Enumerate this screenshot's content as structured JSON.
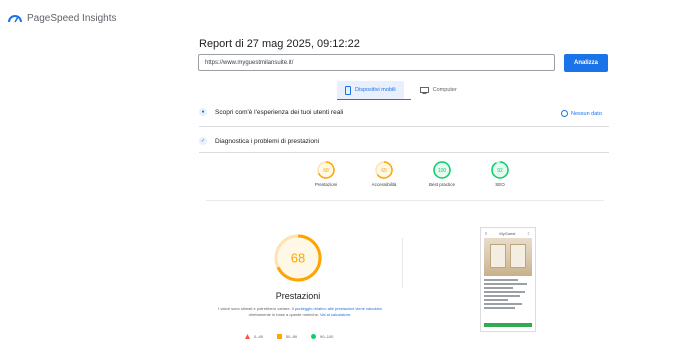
{
  "app": {
    "title": "PageSpeed Insights"
  },
  "report": {
    "title": "Report di 27 mag 2025, 09:12:22"
  },
  "url_input": {
    "value": "https://www.myguestmilansuite.it/"
  },
  "analyze_button": {
    "label": "Analizza"
  },
  "tabs": [
    {
      "label": "Dispositivi mobili",
      "active": true
    },
    {
      "label": "Computer",
      "active": false
    }
  ],
  "sections": {
    "real_users": {
      "label": "Scopri com'è l'esperienza dei tuoi utenti reali",
      "note": "Nessun dato"
    },
    "diagnostics": {
      "label": "Diagnostica i problemi di prestazioni"
    }
  },
  "scores": [
    {
      "label": "Prestazioni",
      "value": 68,
      "color": "#ffa400"
    },
    {
      "label": "Accessibilità",
      "value": 65,
      "color": "#ffa400"
    },
    {
      "label": "Best practice",
      "value": 100,
      "color": "#0cce6b"
    },
    {
      "label": "SEO",
      "value": 92,
      "color": "#0cce6b"
    }
  ],
  "main_score": {
    "label": "Prestazioni",
    "value": 68,
    "color": "#ffa400"
  },
  "description": {
    "text1": "I valori sono stimati e potrebbero variare. Il ",
    "link1": "punteggio relativo alle prestazioni viene calcolato",
    "text2": " direttamente in base a queste metriche. ",
    "link2": "Vai al calcolatore."
  },
  "legend": [
    {
      "range": "0–49",
      "color": "#ff4e42",
      "shape": "triangle"
    },
    {
      "range": "50–89",
      "color": "#ffa400",
      "shape": "square"
    },
    {
      "range": "90–100",
      "color": "#0cce6b",
      "shape": "circle"
    }
  ],
  "phone_preview": {
    "brand": "MyGuest"
  }
}
